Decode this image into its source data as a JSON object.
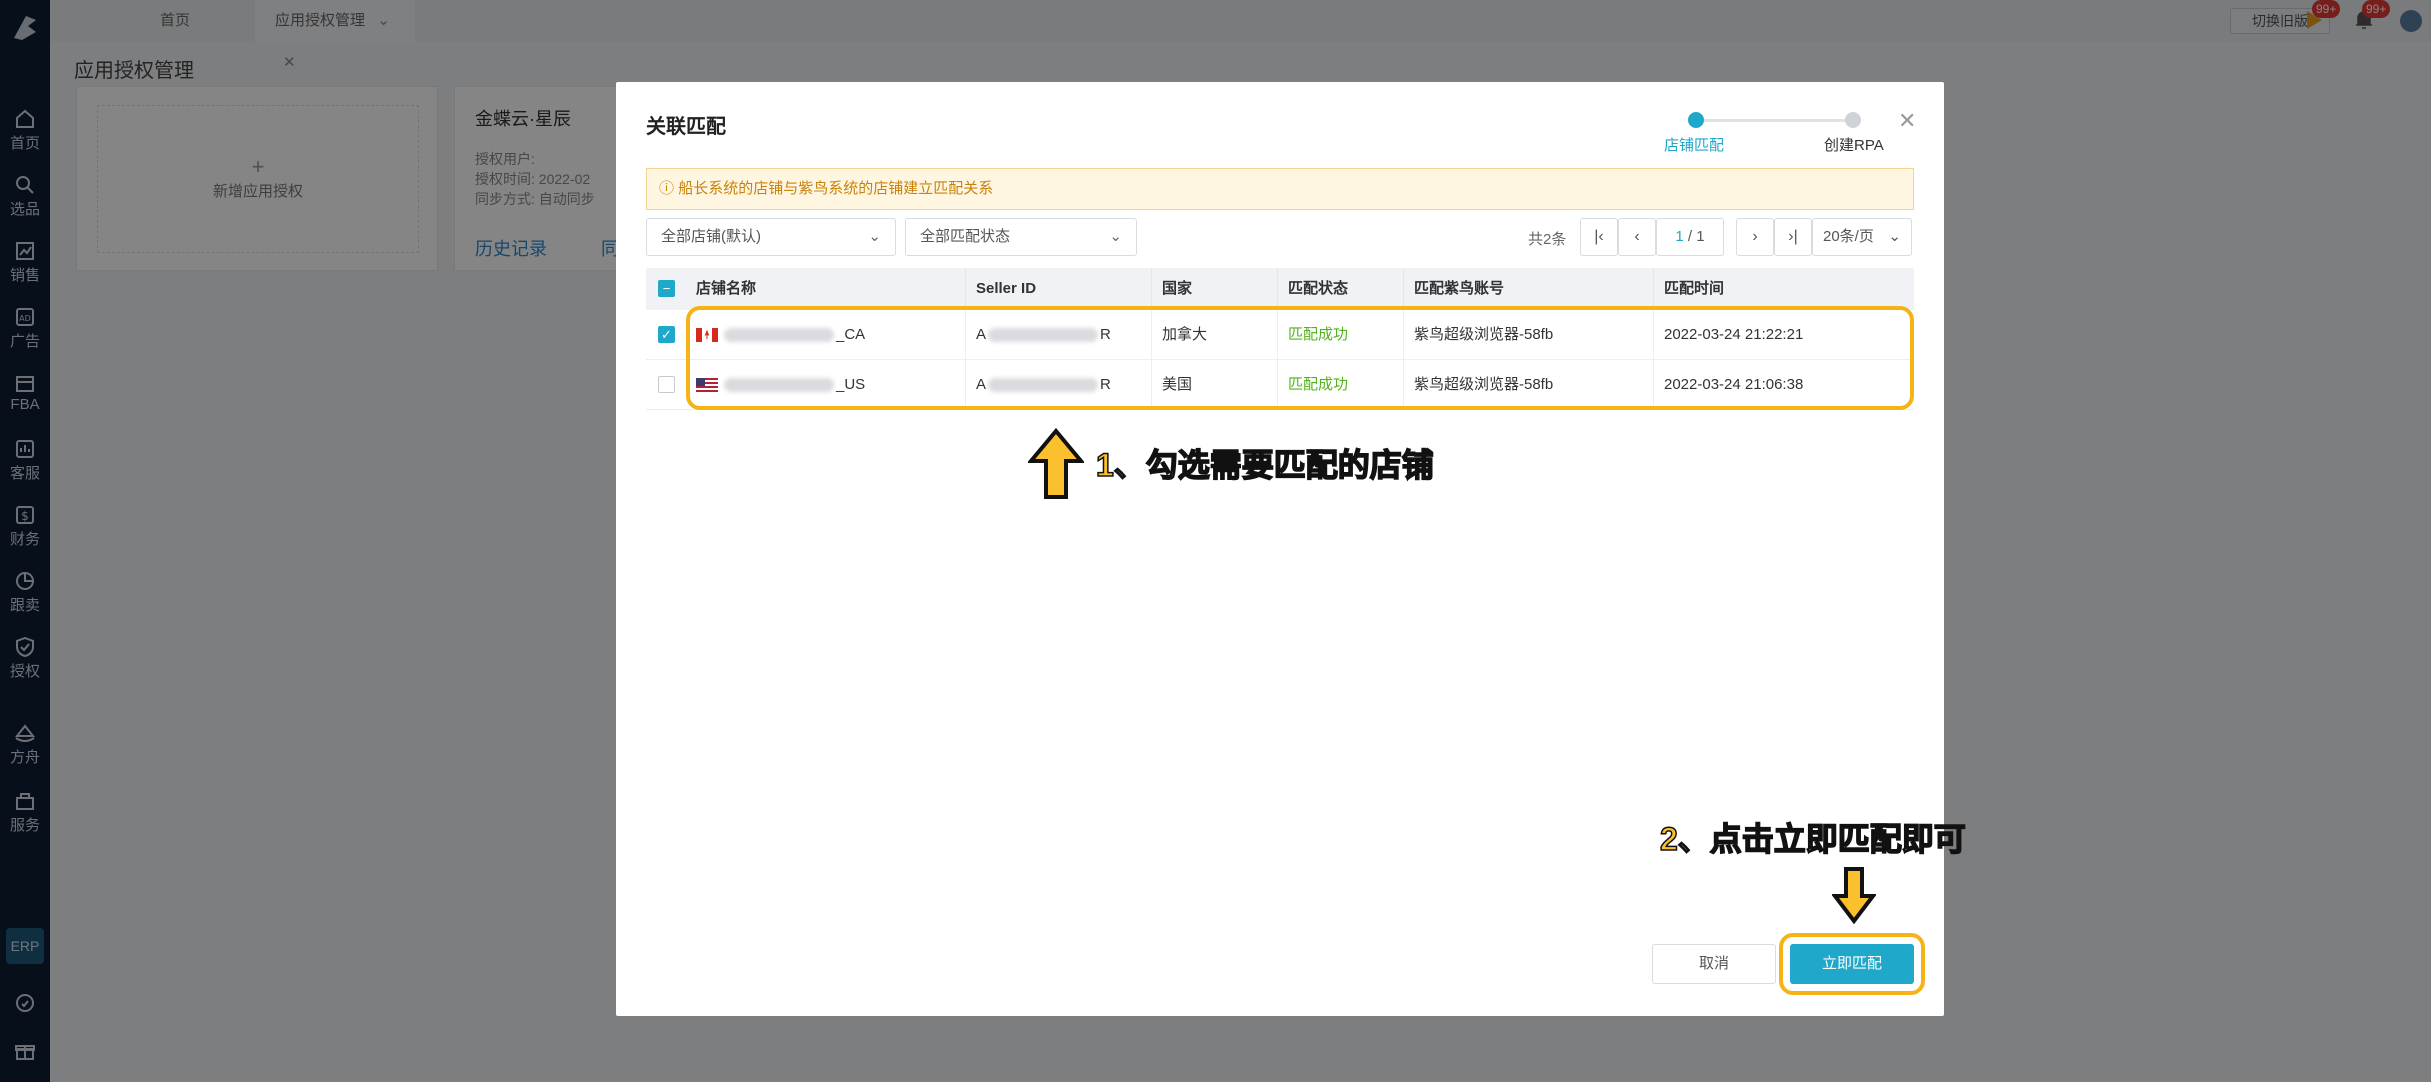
{
  "topbar": {
    "tabs": [
      {
        "label": "首页"
      },
      {
        "label": "应用授权管理"
      }
    ],
    "switch_old_label": "切换旧版",
    "badges": [
      "99+",
      "99+"
    ]
  },
  "sidebar": {
    "items": [
      {
        "label": "首页",
        "icon": "home-icon"
      },
      {
        "label": "选品",
        "icon": "search-icon"
      },
      {
        "label": "销售",
        "icon": "chart-icon"
      },
      {
        "label": "广告",
        "icon": "ad-icon"
      },
      {
        "label": "FBA",
        "icon": "box-icon"
      },
      {
        "label": "客服",
        "icon": "chat-icon"
      },
      {
        "label": "财务",
        "icon": "dollar-icon"
      },
      {
        "label": "跟卖",
        "icon": "pie-icon"
      },
      {
        "label": "授权",
        "icon": "shield-icon"
      },
      {
        "label": "方舟",
        "icon": "ark-icon"
      },
      {
        "label": "服务",
        "icon": "service-icon"
      }
    ],
    "erp_label": "ERP"
  },
  "page": {
    "title": "应用授权管理",
    "add_card_label": "新增应用授权",
    "kingdee": {
      "title": "金蝶云·星辰",
      "rows": [
        "授权用户:",
        "授权时间:  2022-02",
        "同步方式:  自动同步"
      ],
      "link_history": "历史记录",
      "link_other": "同"
    }
  },
  "modal": {
    "title": "关联匹配",
    "steps": [
      {
        "label": "店铺匹配",
        "active": true
      },
      {
        "label": "创建RPA",
        "active": false
      }
    ],
    "notice": "船长系统的店铺与紫鸟系统的店铺建立匹配关系",
    "filters": {
      "store": "全部店铺(默认)",
      "status": "全部匹配状态"
    },
    "pagination": {
      "total": "共2条",
      "current": "1",
      "pages": "/ 1",
      "page_size": "20条/页"
    },
    "table": {
      "headers": [
        "店铺名称",
        "Seller ID",
        "国家",
        "匹配状态",
        "匹配紫鸟账号",
        "匹配时间"
      ],
      "rows": [
        {
          "checked": true,
          "flag": "flag-ca",
          "store_suffix": "_CA",
          "seller_prefix": "A",
          "seller_suffix": "R",
          "country": "加拿大",
          "status": "匹配成功",
          "account": "紫鸟超级浏览器-58fb",
          "time": "2022-03-24 21:22:21"
        },
        {
          "checked": false,
          "flag": "flag-us",
          "store_suffix": "_US",
          "seller_prefix": "A",
          "seller_suffix": "R",
          "country": "美国",
          "status": "匹配成功",
          "account": "紫鸟超级浏览器-58fb",
          "time": "2022-03-24 21:06:38"
        }
      ]
    },
    "annotations": {
      "step1": "1、勾选需要匹配的店铺",
      "step2": "2、点击立即匹配即可"
    },
    "buttons": {
      "cancel": "取消",
      "confirm": "立即匹配"
    }
  },
  "colors": {
    "accent": "#1fa8c9",
    "success": "#52b31b",
    "annotation": "#f5b316",
    "sidebar_bg": "#0f1e35"
  }
}
